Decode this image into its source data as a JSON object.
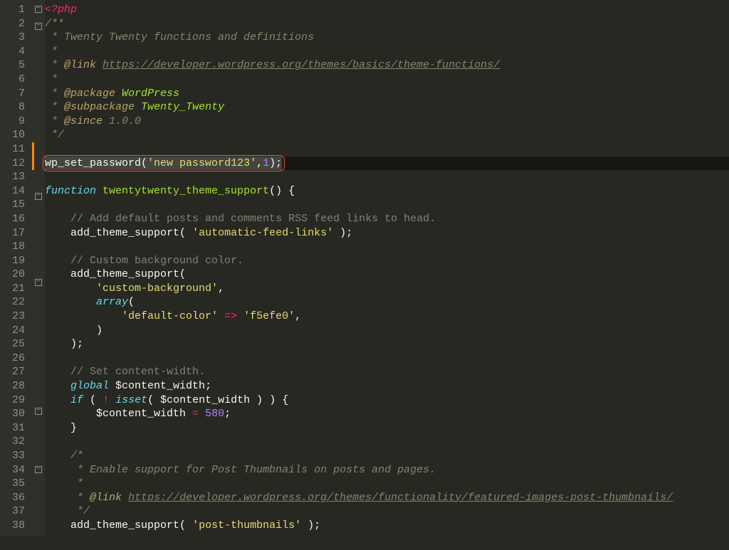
{
  "lines": [
    {
      "n": 1,
      "fold": "box-minus",
      "segs": [
        [
          "c-tag",
          "<?php"
        ]
      ]
    },
    {
      "n": 2,
      "fold": "box-minus",
      "segs": [
        [
          "c-doc",
          "/**"
        ]
      ]
    },
    {
      "n": 3,
      "segs": [
        [
          "c-doc",
          " * Twenty Twenty functions and definitions"
        ]
      ]
    },
    {
      "n": 4,
      "segs": [
        [
          "c-doc",
          " *"
        ]
      ]
    },
    {
      "n": 5,
      "segs": [
        [
          "c-doc",
          " * "
        ],
        [
          "c-ann",
          "@link"
        ],
        [
          "c-doc",
          " "
        ],
        [
          "c-link",
          "https://developer.wordpress.org/themes/basics/theme-functions/"
        ]
      ]
    },
    {
      "n": 6,
      "segs": [
        [
          "c-doc",
          " *"
        ]
      ]
    },
    {
      "n": 7,
      "segs": [
        [
          "c-doc",
          " * "
        ],
        [
          "c-ann",
          "@package"
        ],
        [
          "c-doc",
          " "
        ],
        [
          "c-pkg",
          "WordPress"
        ]
      ]
    },
    {
      "n": 8,
      "segs": [
        [
          "c-doc",
          " * "
        ],
        [
          "c-ann",
          "@subpackage"
        ],
        [
          "c-doc",
          " "
        ],
        [
          "c-pkg",
          "Twenty_Twenty"
        ]
      ]
    },
    {
      "n": 9,
      "segs": [
        [
          "c-doc",
          " * "
        ],
        [
          "c-ann",
          "@since"
        ],
        [
          "c-doc",
          " 1.0.0"
        ]
      ]
    },
    {
      "n": 10,
      "segs": [
        [
          "c-doc",
          " */"
        ]
      ]
    },
    {
      "n": 11,
      "segs": []
    },
    {
      "n": 12,
      "active": true,
      "highlighted": true,
      "segs": [
        [
          "c-def",
          "wp_set_password"
        ],
        [
          "c-paren",
          "("
        ],
        [
          "c-str",
          "'new password123'"
        ],
        [
          "c-def",
          ","
        ],
        [
          "c-num",
          "1"
        ],
        [
          "c-paren",
          ")"
        ],
        [
          "c-def",
          ";"
        ]
      ]
    },
    {
      "n": 13,
      "segs": []
    },
    {
      "n": 14,
      "fold": "box-minus",
      "segs": [
        [
          "c-kw",
          "function"
        ],
        [
          "c-def",
          " "
        ],
        [
          "c-fn",
          "twentytwenty_theme_support"
        ],
        [
          "c-paren",
          "()"
        ],
        [
          "c-def",
          " "
        ],
        [
          "c-paren",
          "{"
        ]
      ]
    },
    {
      "n": 15,
      "segs": []
    },
    {
      "n": 16,
      "segs": [
        [
          "c-def",
          "    "
        ],
        [
          "c-gray",
          "// Add default posts and comments RSS feed links to head."
        ]
      ]
    },
    {
      "n": 17,
      "segs": [
        [
          "c-def",
          "    add_theme_support"
        ],
        [
          "c-paren",
          "("
        ],
        [
          "c-def",
          " "
        ],
        [
          "c-str",
          "'automatic-feed-links'"
        ],
        [
          "c-def",
          " "
        ],
        [
          "c-paren",
          ")"
        ],
        [
          "c-def",
          ";"
        ]
      ]
    },
    {
      "n": 18,
      "segs": []
    },
    {
      "n": 19,
      "segs": [
        [
          "c-def",
          "    "
        ],
        [
          "c-gray",
          "// Custom background color."
        ]
      ]
    },
    {
      "n": 20,
      "fold": "box-minus",
      "segs": [
        [
          "c-def",
          "    add_theme_support"
        ],
        [
          "c-paren",
          "("
        ]
      ]
    },
    {
      "n": 21,
      "segs": [
        [
          "c-def",
          "        "
        ],
        [
          "c-str",
          "'custom-background'"
        ],
        [
          "c-def",
          ","
        ]
      ]
    },
    {
      "n": 22,
      "segs": [
        [
          "c-def",
          "        "
        ],
        [
          "c-kw",
          "array"
        ],
        [
          "c-paren",
          "("
        ]
      ]
    },
    {
      "n": 23,
      "segs": [
        [
          "c-def",
          "            "
        ],
        [
          "c-str",
          "'default-color'"
        ],
        [
          "c-def",
          " "
        ],
        [
          "c-op",
          "=>"
        ],
        [
          "c-def",
          " "
        ],
        [
          "c-str",
          "'f5efe0'"
        ],
        [
          "c-def",
          ","
        ]
      ]
    },
    {
      "n": 24,
      "segs": [
        [
          "c-def",
          "        "
        ],
        [
          "c-paren",
          ")"
        ]
      ]
    },
    {
      "n": 25,
      "segs": [
        [
          "c-def",
          "    "
        ],
        [
          "c-paren",
          ")"
        ],
        [
          "c-def",
          ";"
        ]
      ]
    },
    {
      "n": 26,
      "segs": []
    },
    {
      "n": 27,
      "segs": [
        [
          "c-def",
          "    "
        ],
        [
          "c-gray",
          "// Set content-width."
        ]
      ]
    },
    {
      "n": 28,
      "segs": [
        [
          "c-def",
          "    "
        ],
        [
          "c-kw",
          "global"
        ],
        [
          "c-def",
          " $content_width"
        ],
        [
          "c-def",
          ";"
        ]
      ]
    },
    {
      "n": 29,
      "fold": "box-minus",
      "segs": [
        [
          "c-def",
          "    "
        ],
        [
          "c-kw",
          "if"
        ],
        [
          "c-def",
          " "
        ],
        [
          "c-paren",
          "("
        ],
        [
          "c-def",
          " "
        ],
        [
          "c-op",
          "!"
        ],
        [
          "c-def",
          " "
        ],
        [
          "c-kw",
          "isset"
        ],
        [
          "c-paren",
          "("
        ],
        [
          "c-def",
          " $content_width "
        ],
        [
          "c-paren",
          ")"
        ],
        [
          "c-def",
          " "
        ],
        [
          "c-paren",
          ")"
        ],
        [
          "c-def",
          " "
        ],
        [
          "c-paren",
          "{"
        ]
      ]
    },
    {
      "n": 30,
      "segs": [
        [
          "c-def",
          "        $content_width "
        ],
        [
          "c-op",
          "="
        ],
        [
          "c-def",
          " "
        ],
        [
          "c-num",
          "580"
        ],
        [
          "c-def",
          ";"
        ]
      ]
    },
    {
      "n": 31,
      "segs": [
        [
          "c-def",
          "    "
        ],
        [
          "c-paren",
          "}"
        ]
      ]
    },
    {
      "n": 32,
      "segs": []
    },
    {
      "n": 33,
      "fold": "box-minus",
      "segs": [
        [
          "c-def",
          "    "
        ],
        [
          "c-doc",
          "/*"
        ]
      ]
    },
    {
      "n": 34,
      "segs": [
        [
          "c-def",
          "    "
        ],
        [
          "c-doc",
          " * Enable support for Post Thumbnails on posts and pages."
        ]
      ]
    },
    {
      "n": 35,
      "segs": [
        [
          "c-def",
          "    "
        ],
        [
          "c-doc",
          " *"
        ]
      ]
    },
    {
      "n": 36,
      "segs": [
        [
          "c-def",
          "    "
        ],
        [
          "c-doc",
          " * "
        ],
        [
          "c-ann",
          "@link"
        ],
        [
          "c-doc",
          " "
        ],
        [
          "c-link",
          "https://developer.wordpress.org/themes/functionality/featured-images-post-thumbnails/"
        ]
      ]
    },
    {
      "n": 37,
      "segs": [
        [
          "c-def",
          "    "
        ],
        [
          "c-doc",
          " */"
        ]
      ]
    },
    {
      "n": 38,
      "segs": [
        [
          "c-def",
          "    add_theme_support"
        ],
        [
          "c-paren",
          "("
        ],
        [
          "c-def",
          " "
        ],
        [
          "c-str",
          "'post-thumbnails'"
        ],
        [
          "c-def",
          " "
        ],
        [
          "c-paren",
          ")"
        ],
        [
          "c-def",
          ";"
        ]
      ]
    }
  ]
}
